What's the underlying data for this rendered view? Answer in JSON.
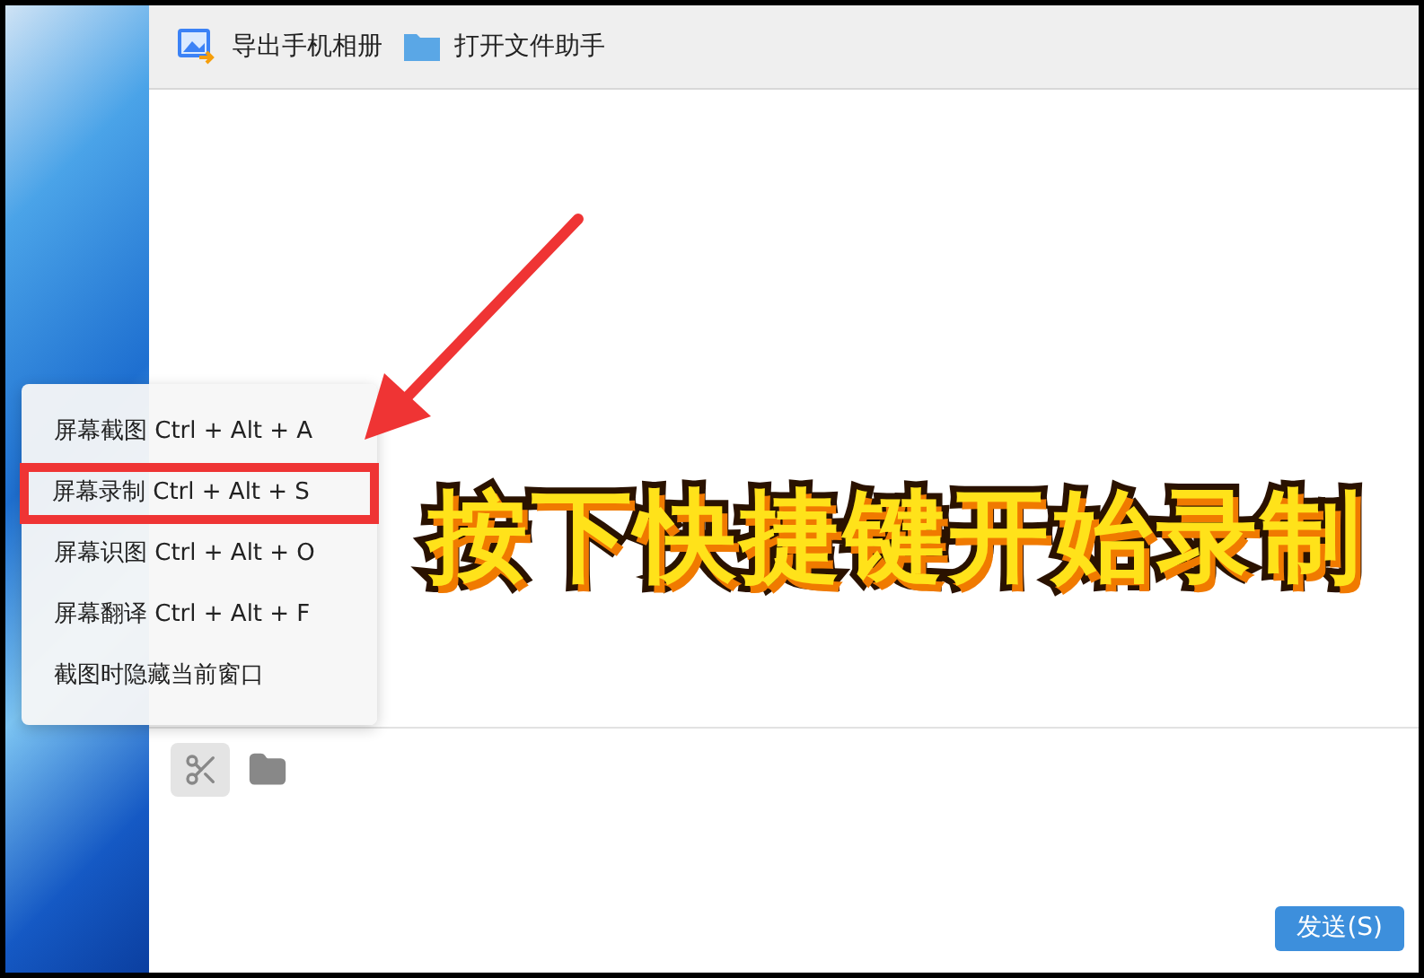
{
  "toolbar": [
    {
      "kind": "export",
      "label": "导出手机相册"
    },
    {
      "kind": "folder",
      "label": "打开文件助手"
    }
  ],
  "menu": [
    {
      "label": "屏幕截图 Ctrl + Alt + A",
      "highlighted": false
    },
    {
      "label": "屏幕录制 Ctrl + Alt + S",
      "highlighted": true
    },
    {
      "label": "屏幕识图 Ctrl + Alt + O",
      "highlighted": false
    },
    {
      "label": "屏幕翻译 Ctrl + Alt + F",
      "highlighted": false
    },
    {
      "label": "截图时隐藏当前窗口",
      "highlighted": false
    }
  ],
  "input_tools": [
    {
      "kind": "scissors",
      "selected": true
    },
    {
      "kind": "folder",
      "selected": false
    }
  ],
  "caption": "按下快捷键开始录制",
  "send_button": "发送(S)"
}
